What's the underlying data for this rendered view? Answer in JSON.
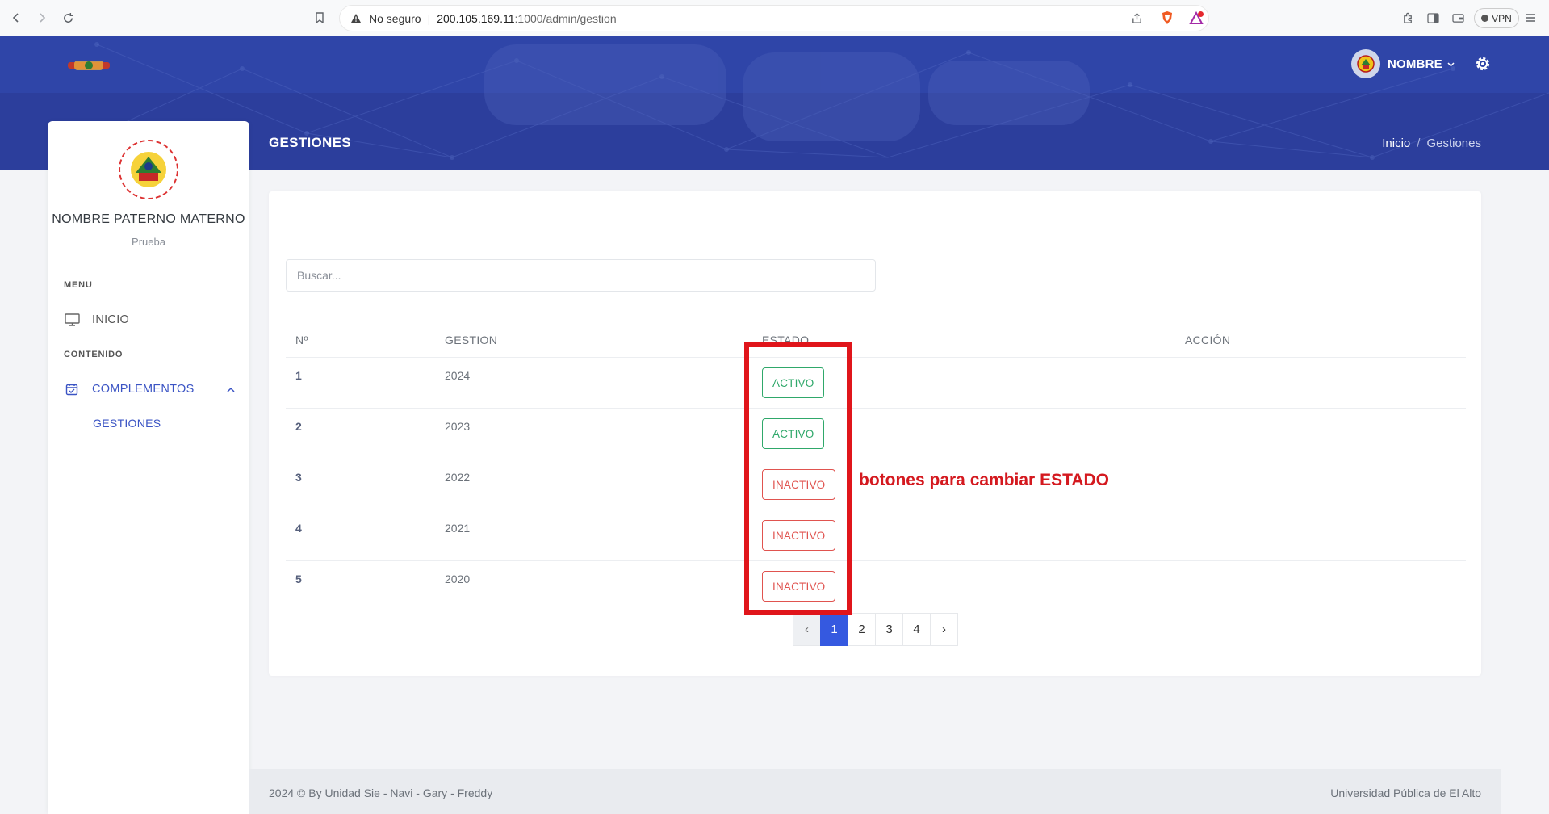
{
  "browser": {
    "security_label": "No seguro",
    "url_host": "200.105.169.11",
    "url_path": ":1000/admin/gestion",
    "vpn_label": "VPN"
  },
  "header": {
    "user_name": "NOMBRE",
    "page_title": "GESTIONES",
    "breadcrumb": [
      "Inicio",
      "Gestiones"
    ]
  },
  "sidebar": {
    "user_full_name": "NOMBRE PATERNO MATERNO",
    "user_role": "Prueba",
    "section_menu": "MENU",
    "item_inicio": "INICIO",
    "section_contenido": "CONTENIDO",
    "item_complementos": "COMPLEMENTOS",
    "subitem_gestiones": "GESTIONES"
  },
  "main": {
    "search_placeholder": "Buscar...",
    "columns": [
      "Nº",
      "GESTION",
      "ESTADO",
      "ACCIÓN"
    ],
    "rows": [
      {
        "n": "1",
        "gestion": "2024",
        "estado": "ACTIVO"
      },
      {
        "n": "2",
        "gestion": "2023",
        "estado": "ACTIVO"
      },
      {
        "n": "3",
        "gestion": "2022",
        "estado": "INACTIVO"
      },
      {
        "n": "4",
        "gestion": "2021",
        "estado": "INACTIVO"
      },
      {
        "n": "5",
        "gestion": "2020",
        "estado": "INACTIVO"
      }
    ],
    "pagination": {
      "prev": "‹",
      "pages": [
        "1",
        "2",
        "3",
        "4"
      ],
      "next": "›",
      "current": "1"
    }
  },
  "annotation": {
    "text": "botones para cambiar ESTADO"
  },
  "footer": {
    "left": "2024 © By Unidad Sie - Navi - Gary - Freddy",
    "right": "Universidad Pública de El Alto"
  },
  "colors": {
    "header_blue": "#2c3e9c",
    "accent": "#3559e0",
    "activo": "#2fa86a",
    "inactivo": "#e0534f",
    "annotation_red": "#e0151b"
  }
}
